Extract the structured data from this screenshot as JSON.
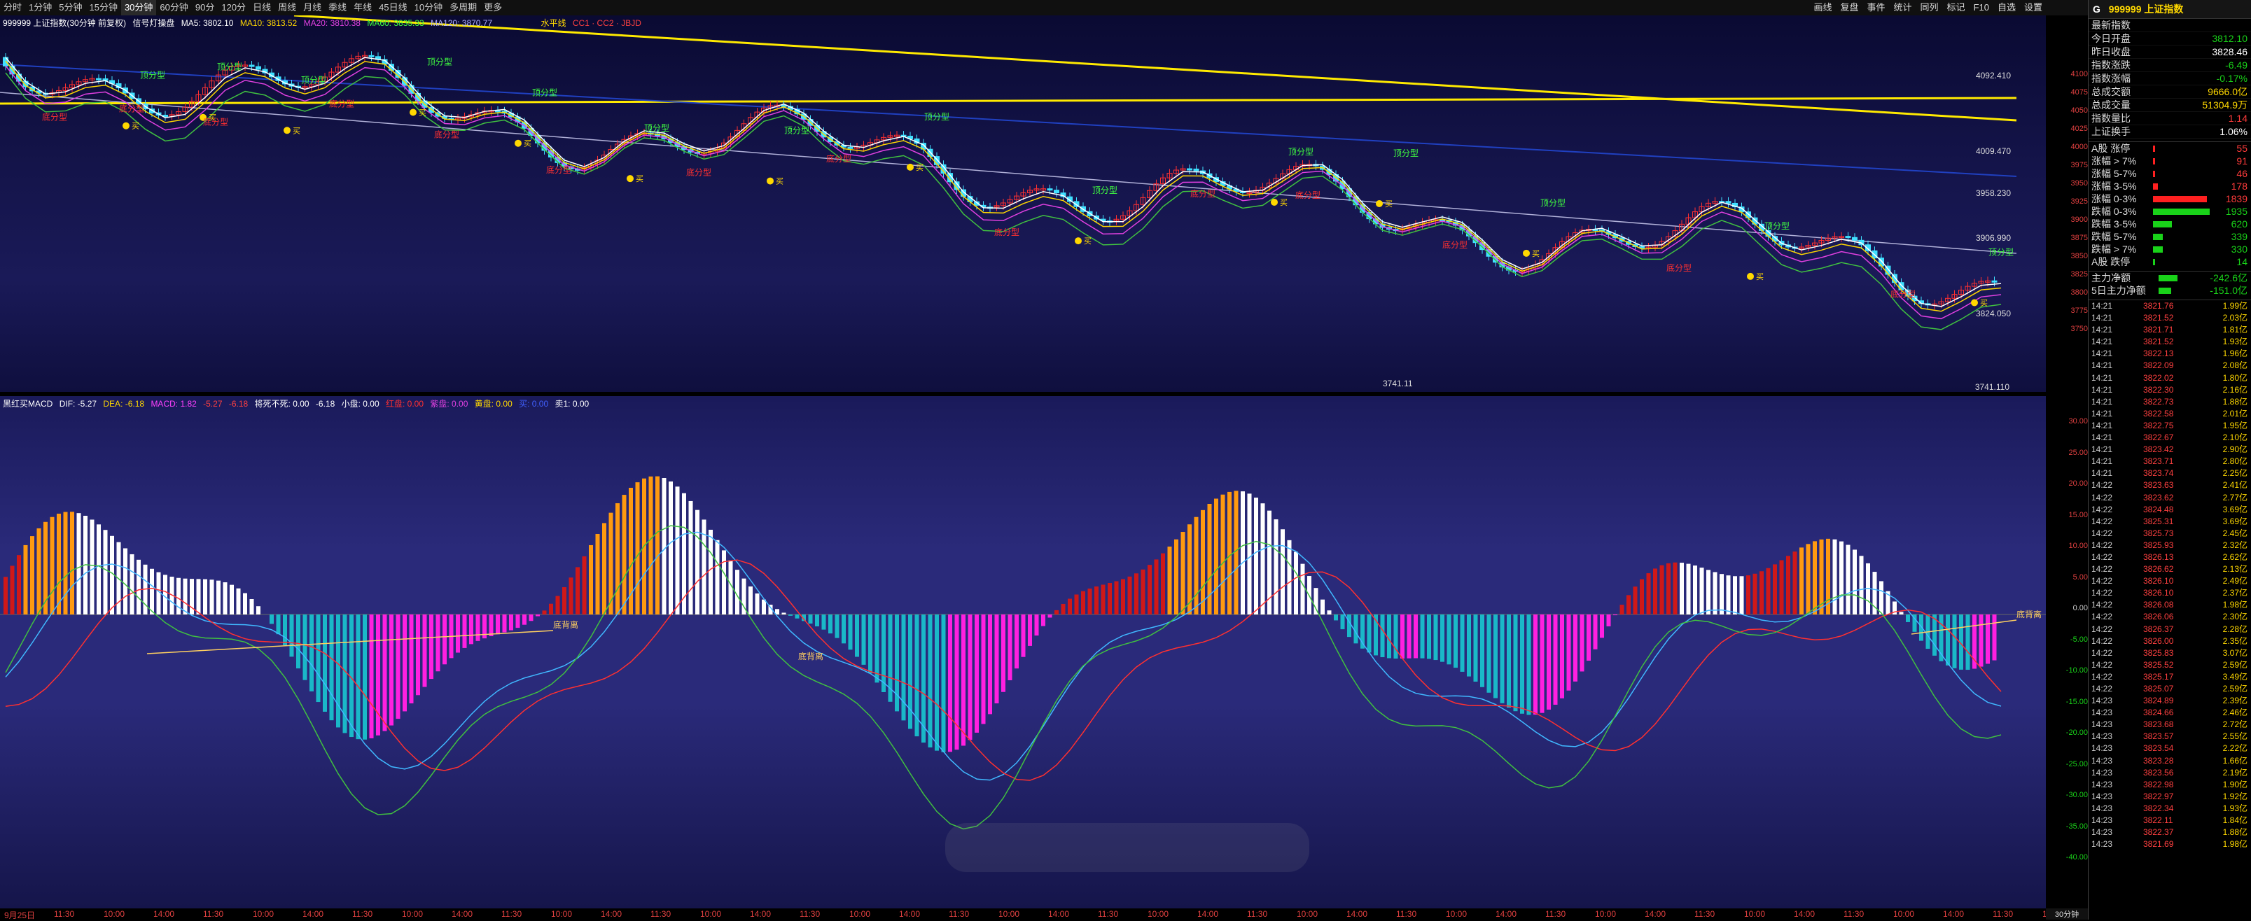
{
  "toolbar": {
    "periods": [
      "分时",
      "1分钟",
      "5分钟",
      "15分钟",
      "30分钟",
      "60分钟",
      "90分",
      "120分",
      "日线",
      "周线",
      "月线",
      "季线",
      "年线",
      "45日线",
      "10分钟",
      "多周期",
      "更多"
    ],
    "active_period": "30分钟",
    "right_items": [
      "画线",
      "复盘",
      "事件",
      "统计",
      "同列",
      "标记",
      "F10",
      "自选",
      "设置"
    ]
  },
  "main_legend": {
    "title": "999999 上证指数(30分钟 前复权)",
    "indicator": "信号灯操盘",
    "ma5": "MA5: 3802.10",
    "ma10": "MA10: 3813.52",
    "ma20": "MA20: 3810.38",
    "macd_ma": "MA60: 3835.33",
    "ma120": "MA120: 3870.77",
    "extra": "水平线",
    "cc": "CC1 · CC2 · JBJD"
  },
  "sub_legend": {
    "title": "黑红买MACD",
    "dif": "DIF: -5.27",
    "dea": "DEA: -6.18",
    "macd": "MACD: 1.82",
    "v1": "-5.27",
    "v2": "-6.18",
    "ext": "将死不死: 0.00",
    "ext2": "-6.18",
    "small": "小盘: 0.00",
    "red": "红盘: 0.00",
    "purple": "紫盘: 0.00",
    "yellow": "黄盘: 0.00",
    "buy": "买: 0.00",
    "sell": "卖1: 0.00"
  },
  "main_yaxis": [
    "4100",
    "4075",
    "4050",
    "4025",
    "4000",
    "3975",
    "3950",
    "3925",
    "3900",
    "3875",
    "3850",
    "3825",
    "3800",
    "3775",
    "3750"
  ],
  "sub_yaxis": [
    "30.00",
    "25.00",
    "20.00",
    "15.00",
    "10.00",
    "5.00",
    "0.00",
    "-5.00",
    "-10.00",
    "-15.00",
    "-20.00",
    "-25.00",
    "-30.00",
    "-35.00",
    "-40.00"
  ],
  "price_labels": {
    "p1": "4092.410",
    "p2": "4009.470",
    "p3": "3958.230",
    "p4": "3906.990",
    "p5": "3824.050",
    "low": "3741.11",
    "low2": "3741.110"
  },
  "signals": {
    "buy": "买",
    "top": "顶分型",
    "bottom": "底分型",
    "divergence": "底背离"
  },
  "date_axis": [
    "9月25日",
    "11:30",
    "10:00",
    "14:00",
    "11:30",
    "10:00",
    "14:00",
    "11:30",
    "10:00",
    "14:00",
    "11:30",
    "10:00",
    "14:00",
    "11:30",
    "10:00",
    "14:00",
    "11:30",
    "10:00",
    "14:00",
    "11:30",
    "10:00",
    "14:00",
    "11:30",
    "10:00",
    "14:00",
    "11:30",
    "10:00",
    "14:00",
    "11:30",
    "10:00",
    "14:00",
    "11:30",
    "10:00",
    "14:00",
    "11:30",
    "10:00",
    "14:00",
    "11:30",
    "10:00",
    "14:00",
    "11:30",
    "10:00",
    "14:00"
  ],
  "period_tab": "30分钟",
  "right_panel": {
    "title": "999999 上证指数",
    "title_prefix": "G",
    "quotes": [
      {
        "label": "最新指数",
        "value": "",
        "cls": "red"
      },
      {
        "label": "今日开盘",
        "value": "3812.10",
        "cls": "green"
      },
      {
        "label": "昨日收盘",
        "value": "3828.46",
        "cls": "white"
      },
      {
        "label": "指数涨跌",
        "value": "-6.49",
        "cls": "green"
      },
      {
        "label": "指数涨幅",
        "value": "-0.17%",
        "cls": "green"
      },
      {
        "label": "总成交额",
        "value": "9666.0亿",
        "cls": "yellow"
      },
      {
        "label": "总成交量",
        "value": "51304.9万",
        "cls": "yellow"
      },
      {
        "label": "指数量比",
        "value": "1.14",
        "cls": "red"
      },
      {
        "label": "上证换手",
        "value": "1.06%",
        "cls": "white"
      }
    ],
    "breadth": [
      {
        "label": "A股 涨停",
        "value": "55",
        "color": "#ff2020",
        "frac": 0.02,
        "cls": "red"
      },
      {
        "label": "涨幅 > 7%",
        "value": "91",
        "color": "#ff2020",
        "frac": 0.03,
        "cls": "red"
      },
      {
        "label": "涨幅 5-7%",
        "value": "46",
        "color": "#ff2020",
        "frac": 0.02,
        "cls": "red"
      },
      {
        "label": "涨幅 3-5%",
        "value": "178",
        "color": "#ff2020",
        "frac": 0.08,
        "cls": "red"
      },
      {
        "label": "涨幅 0-3%",
        "value": "1839",
        "color": "#ff2020",
        "frac": 0.85,
        "cls": "red"
      },
      {
        "label": "跌幅 0-3%",
        "value": "1935",
        "color": "#19d219",
        "frac": 0.9,
        "cls": "green"
      },
      {
        "label": "跌幅 3-5%",
        "value": "620",
        "color": "#19d219",
        "frac": 0.3,
        "cls": "green"
      },
      {
        "label": "跌幅 5-7%",
        "value": "339",
        "color": "#19d219",
        "frac": 0.16,
        "cls": "green"
      },
      {
        "label": "跌幅 > 7%",
        "value": "330",
        "color": "#19d219",
        "frac": 0.15,
        "cls": "green"
      },
      {
        "label": "A股 跌停",
        "value": "14",
        "color": "#19d219",
        "frac": 0.01,
        "cls": "green"
      }
    ],
    "capital": [
      {
        "label": "主力净额",
        "value": "-242.6亿",
        "frac": 0.3
      },
      {
        "label": "5日主力净额",
        "value": "-151.0亿",
        "frac": 0.2
      }
    ],
    "ticks": [
      {
        "t": "14:21",
        "p": "3821.76",
        "a": "1.99亿"
      },
      {
        "t": "14:21",
        "p": "3821.52",
        "a": "2.03亿"
      },
      {
        "t": "14:21",
        "p": "3821.71",
        "a": "1.81亿"
      },
      {
        "t": "14:21",
        "p": "3821.52",
        "a": "1.93亿"
      },
      {
        "t": "14:21",
        "p": "3822.13",
        "a": "1.96亿"
      },
      {
        "t": "14:21",
        "p": "3822.09",
        "a": "2.08亿"
      },
      {
        "t": "14:21",
        "p": "3822.02",
        "a": "1.80亿"
      },
      {
        "t": "14:21",
        "p": "3822.30",
        "a": "2.16亿"
      },
      {
        "t": "14:21",
        "p": "3822.73",
        "a": "1.88亿"
      },
      {
        "t": "14:21",
        "p": "3822.58",
        "a": "2.01亿"
      },
      {
        "t": "14:21",
        "p": "3822.75",
        "a": "1.95亿"
      },
      {
        "t": "14:21",
        "p": "3822.67",
        "a": "2.10亿"
      },
      {
        "t": "14:21",
        "p": "3823.42",
        "a": "2.90亿"
      },
      {
        "t": "14:21",
        "p": "3823.71",
        "a": "2.80亿"
      },
      {
        "t": "14:21",
        "p": "3823.74",
        "a": "2.25亿"
      },
      {
        "t": "14:22",
        "p": "3823.63",
        "a": "2.41亿"
      },
      {
        "t": "14:22",
        "p": "3823.62",
        "a": "2.77亿"
      },
      {
        "t": "14:22",
        "p": "3824.48",
        "a": "3.69亿"
      },
      {
        "t": "14:22",
        "p": "3825.31",
        "a": "3.69亿"
      },
      {
        "t": "14:22",
        "p": "3825.73",
        "a": "2.45亿"
      },
      {
        "t": "14:22",
        "p": "3825.93",
        "a": "2.32亿"
      },
      {
        "t": "14:22",
        "p": "3826.13",
        "a": "2.62亿"
      },
      {
        "t": "14:22",
        "p": "3826.62",
        "a": "2.13亿"
      },
      {
        "t": "14:22",
        "p": "3826.10",
        "a": "2.49亿"
      },
      {
        "t": "14:22",
        "p": "3826.10",
        "a": "2.37亿"
      },
      {
        "t": "14:22",
        "p": "3826.08",
        "a": "1.98亿"
      },
      {
        "t": "14:22",
        "p": "3826.06",
        "a": "2.30亿"
      },
      {
        "t": "14:22",
        "p": "3826.37",
        "a": "2.28亿"
      },
      {
        "t": "14:22",
        "p": "3826.00",
        "a": "2.35亿"
      },
      {
        "t": "14:22",
        "p": "3825.83",
        "a": "3.07亿"
      },
      {
        "t": "14:22",
        "p": "3825.52",
        "a": "2.59亿"
      },
      {
        "t": "14:22",
        "p": "3825.17",
        "a": "3.49亿"
      },
      {
        "t": "14:22",
        "p": "3825.07",
        "a": "2.59亿"
      },
      {
        "t": "14:23",
        "p": "3824.89",
        "a": "2.39亿"
      },
      {
        "t": "14:23",
        "p": "3824.66",
        "a": "2.46亿"
      },
      {
        "t": "14:23",
        "p": "3823.68",
        "a": "2.72亿"
      },
      {
        "t": "14:23",
        "p": "3823.57",
        "a": "2.55亿"
      },
      {
        "t": "14:23",
        "p": "3823.54",
        "a": "2.22亿"
      },
      {
        "t": "14:23",
        "p": "3823.28",
        "a": "1.66亿"
      },
      {
        "t": "14:23",
        "p": "3823.56",
        "a": "2.19亿"
      },
      {
        "t": "14:23",
        "p": "3822.98",
        "a": "1.90亿"
      },
      {
        "t": "14:23",
        "p": "3822.97",
        "a": "1.92亿"
      },
      {
        "t": "14:23",
        "p": "3822.34",
        "a": "1.93亿"
      },
      {
        "t": "14:23",
        "p": "3822.11",
        "a": "1.84亿"
      },
      {
        "t": "14:23",
        "p": "3822.37",
        "a": "1.88亿"
      },
      {
        "t": "14:23",
        "p": "3821.69",
        "a": "1.98亿"
      }
    ]
  },
  "colors": {
    "up_candle": "#ff3030",
    "down_candle": "#40e0ff",
    "trendline": "#ffea00",
    "macd_red": "#d01818",
    "macd_orange": "#ff9a10",
    "macd_white": "#ffffff",
    "macd_cyan": "#1ab8c8",
    "macd_magenta": "#ff20e0"
  }
}
